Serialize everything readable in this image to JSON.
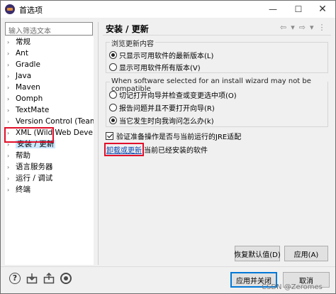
{
  "window": {
    "title": "首选项",
    "min_glyph": "—",
    "max_glyph": "☐",
    "close_glyph": "✕"
  },
  "filter": {
    "placeholder": "输入筛选文本"
  },
  "tree": {
    "items": [
      {
        "label": "常规",
        "expandable": true
      },
      {
        "label": "Ant",
        "expandable": true
      },
      {
        "label": "Gradle",
        "expandable": true
      },
      {
        "label": "Java",
        "expandable": true
      },
      {
        "label": "Maven",
        "expandable": true
      },
      {
        "label": "Oomph",
        "expandable": true
      },
      {
        "label": "TextMate",
        "expandable": true
      },
      {
        "label": "Version Control (Team)",
        "expandable": true
      },
      {
        "label": "XML (Wild Web Developer)",
        "expandable": true
      },
      {
        "label": "安装 / 更新",
        "expandable": true,
        "selected": true
      },
      {
        "label": "帮助",
        "expandable": true
      },
      {
        "label": "语言服务器",
        "expandable": true
      },
      {
        "label": "运行 / 调试",
        "expandable": true
      },
      {
        "label": "终端",
        "expandable": true
      }
    ]
  },
  "page": {
    "title": "安装 / 更新",
    "nav": {
      "back": "⇦",
      "back_menu": "▾",
      "forward": "⇨",
      "forward_menu": "▾",
      "more": "⋮"
    }
  },
  "group_browse": {
    "legend": "浏览更新内容",
    "options": [
      {
        "label": "只显示可用软件的最新版本(L)",
        "selected": true
      },
      {
        "label": "显示可用软件所有版本(V)",
        "selected": false
      }
    ]
  },
  "group_wizard": {
    "legend": "When software selected for an install wizard may not be compatible",
    "options": [
      {
        "label": "切记打开向导并检查或变更选中项(O)",
        "selected": false
      },
      {
        "label": "报告问题并且不要打开向导(R)",
        "selected": false
      },
      {
        "label": "当它发生时向我询问怎么办(k)",
        "selected": true
      }
    ]
  },
  "verify": {
    "label": "验证准备操作是否与当前运行的JRE适配",
    "checked": true
  },
  "uninstall": {
    "link": "卸载或更新",
    "suffix": "当前已经安装的软件"
  },
  "buttons": {
    "restore": "恢复默认值(D)",
    "apply": "应用(A)",
    "apply_close": "应用并关闭",
    "cancel": "取消"
  },
  "bottom_icons": [
    "help-icon",
    "import-icon",
    "export-icon",
    "record-icon"
  ],
  "watermark": "CSDN @Zeromes"
}
